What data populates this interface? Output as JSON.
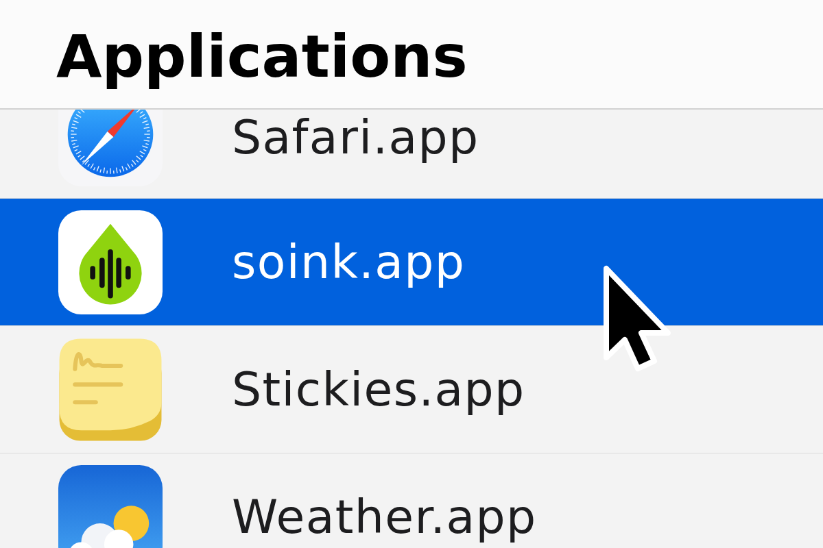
{
  "header": {
    "title": "Applications"
  },
  "files": [
    {
      "name": "Safari.app",
      "selected": false
    },
    {
      "name": "soink.app",
      "selected": true
    },
    {
      "name": "Stickies.app",
      "selected": false
    },
    {
      "name": "Weather.app",
      "selected": false
    }
  ]
}
